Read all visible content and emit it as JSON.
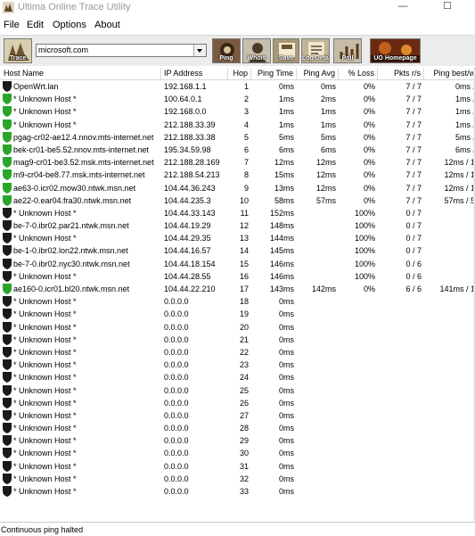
{
  "window": {
    "title": "Ultima Online Trace Utility",
    "minimize_glyph": "—",
    "maximize_glyph": "☐"
  },
  "menu": [
    "File",
    "Edit",
    "Options",
    "About"
  ],
  "toolbar": {
    "host_value": "microsoft.com",
    "buttons": [
      {
        "label": "Trace",
        "icon": "trace-icon",
        "color": "#d8cfae"
      },
      {
        "label": "Ping",
        "icon": "ping-icon",
        "color": "#7b5b3f"
      },
      {
        "label": "Whois",
        "icon": "whois-icon",
        "color": "#c9bfae"
      },
      {
        "label": "Save",
        "icon": "save-icon",
        "color": "#a89676"
      },
      {
        "label": "Log Details",
        "icon": "log-details-icon",
        "color": "#c2b596"
      },
      {
        "label": "Poll",
        "icon": "poll-icon",
        "color": "#c6bda7"
      },
      {
        "label": "UO Homepage",
        "icon": "uo-homepage-icon",
        "color": "#6a2a12"
      }
    ]
  },
  "columns": [
    "Host Name",
    "IP Address",
    "Hop",
    "Ping Time",
    "Ping Avg",
    "% Loss",
    "Pkts r/s",
    "Ping best/w"
  ],
  "status_colors": {
    "ok": "#2aa52a",
    "dark": "#1a1a1a"
  },
  "rows": [
    {
      "status": "dark",
      "host": "OpenWrt.lan",
      "ip": "192.168.1.1",
      "hop": "1",
      "time": "0ms",
      "avg": "0ms",
      "loss": "0%",
      "pkts": "7 / 7",
      "bw": "0ms /"
    },
    {
      "status": "ok",
      "host": "* Unknown Host *",
      "ip": "100.64.0.1",
      "hop": "2",
      "time": "1ms",
      "avg": "2ms",
      "loss": "0%",
      "pkts": "7 / 7",
      "bw": "1ms /"
    },
    {
      "status": "ok",
      "host": "* Unknown Host *",
      "ip": "192.168.0.0",
      "hop": "3",
      "time": "1ms",
      "avg": "1ms",
      "loss": "0%",
      "pkts": "7 / 7",
      "bw": "1ms /"
    },
    {
      "status": "ok",
      "host": "* Unknown Host *",
      "ip": "212.188.33.39",
      "hop": "4",
      "time": "1ms",
      "avg": "1ms",
      "loss": "0%",
      "pkts": "7 / 7",
      "bw": "1ms /"
    },
    {
      "status": "ok",
      "host": "pgag-cr02-ae12.4.nnov.mts-internet.net",
      "ip": "212.188.33.38",
      "hop": "5",
      "time": "5ms",
      "avg": "5ms",
      "loss": "0%",
      "pkts": "7 / 7",
      "bw": "5ms /"
    },
    {
      "status": "ok",
      "host": "bek-cr01-be5.52.nnov.mts-internet.net",
      "ip": "195.34.59.98",
      "hop": "6",
      "time": "6ms",
      "avg": "6ms",
      "loss": "0%",
      "pkts": "7 / 7",
      "bw": "6ms /"
    },
    {
      "status": "ok",
      "host": "mag9-cr01-be3.52.msk.mts-internet.net",
      "ip": "212.188.28.169",
      "hop": "7",
      "time": "12ms",
      "avg": "12ms",
      "loss": "0%",
      "pkts": "7 / 7",
      "bw": "12ms / 1"
    },
    {
      "status": "ok",
      "host": "m9-cr04-be8.77.msk.mts-internet.net",
      "ip": "212.188.54.213",
      "hop": "8",
      "time": "15ms",
      "avg": "12ms",
      "loss": "0%",
      "pkts": "7 / 7",
      "bw": "12ms / 1"
    },
    {
      "status": "ok",
      "host": "ae63-0.icr02.mow30.ntwk.msn.net",
      "ip": "104.44.36.243",
      "hop": "9",
      "time": "13ms",
      "avg": "12ms",
      "loss": "0%",
      "pkts": "7 / 7",
      "bw": "12ms / 1"
    },
    {
      "status": "ok",
      "host": "ae22-0.ear04.fra30.ntwk.msn.net",
      "ip": "104.44.235.3",
      "hop": "10",
      "time": "58ms",
      "avg": "57ms",
      "loss": "0%",
      "pkts": "7 / 7",
      "bw": "57ms / 5"
    },
    {
      "status": "dark",
      "host": "* Unknown Host *",
      "ip": "104.44.33.143",
      "hop": "11",
      "time": "152ms",
      "avg": "",
      "loss": "100%",
      "pkts": "0 / 7",
      "bw": ""
    },
    {
      "status": "dark",
      "host": "be-7-0.ibr02.par21.ntwk.msn.net",
      "ip": "104.44.19.29",
      "hop": "12",
      "time": "148ms",
      "avg": "",
      "loss": "100%",
      "pkts": "0 / 7",
      "bw": ""
    },
    {
      "status": "dark",
      "host": "* Unknown Host *",
      "ip": "104.44.29.35",
      "hop": "13",
      "time": "144ms",
      "avg": "",
      "loss": "100%",
      "pkts": "0 / 7",
      "bw": ""
    },
    {
      "status": "dark",
      "host": "be-1-0.ibr02.lon22.ntwk.msn.net",
      "ip": "104.44.16.57",
      "hop": "14",
      "time": "145ms",
      "avg": "",
      "loss": "100%",
      "pkts": "0 / 7",
      "bw": ""
    },
    {
      "status": "dark",
      "host": "be-7-0.ibr02.nyc30.ntwk.msn.net",
      "ip": "104.44.18.154",
      "hop": "15",
      "time": "146ms",
      "avg": "",
      "loss": "100%",
      "pkts": "0 / 6",
      "bw": ""
    },
    {
      "status": "dark",
      "host": "* Unknown Host *",
      "ip": "104.44.28.55",
      "hop": "16",
      "time": "146ms",
      "avg": "",
      "loss": "100%",
      "pkts": "0 / 6",
      "bw": ""
    },
    {
      "status": "ok",
      "host": "ae160-0.icr01.bl20.ntwk.msn.net",
      "ip": "104.44.22.210",
      "hop": "17",
      "time": "143ms",
      "avg": "142ms",
      "loss": "0%",
      "pkts": "6 / 6",
      "bw": "141ms / 1"
    },
    {
      "status": "dark",
      "host": "* Unknown Host *",
      "ip": "0.0.0.0",
      "hop": "18",
      "time": "0ms",
      "avg": "",
      "loss": "",
      "pkts": "",
      "bw": ""
    },
    {
      "status": "dark",
      "host": "* Unknown Host *",
      "ip": "0.0.0.0",
      "hop": "19",
      "time": "0ms",
      "avg": "",
      "loss": "",
      "pkts": "",
      "bw": ""
    },
    {
      "status": "dark",
      "host": "* Unknown Host *",
      "ip": "0.0.0.0",
      "hop": "20",
      "time": "0ms",
      "avg": "",
      "loss": "",
      "pkts": "",
      "bw": ""
    },
    {
      "status": "dark",
      "host": "* Unknown Host *",
      "ip": "0.0.0.0",
      "hop": "21",
      "time": "0ms",
      "avg": "",
      "loss": "",
      "pkts": "",
      "bw": ""
    },
    {
      "status": "dark",
      "host": "* Unknown Host *",
      "ip": "0.0.0.0",
      "hop": "22",
      "time": "0ms",
      "avg": "",
      "loss": "",
      "pkts": "",
      "bw": ""
    },
    {
      "status": "dark",
      "host": "* Unknown Host *",
      "ip": "0.0.0.0",
      "hop": "23",
      "time": "0ms",
      "avg": "",
      "loss": "",
      "pkts": "",
      "bw": ""
    },
    {
      "status": "dark",
      "host": "* Unknown Host *",
      "ip": "0.0.0.0",
      "hop": "24",
      "time": "0ms",
      "avg": "",
      "loss": "",
      "pkts": "",
      "bw": ""
    },
    {
      "status": "dark",
      "host": "* Unknown Host *",
      "ip": "0.0.0.0",
      "hop": "25",
      "time": "0ms",
      "avg": "",
      "loss": "",
      "pkts": "",
      "bw": ""
    },
    {
      "status": "dark",
      "host": "* Unknown Host *",
      "ip": "0.0.0.0",
      "hop": "26",
      "time": "0ms",
      "avg": "",
      "loss": "",
      "pkts": "",
      "bw": ""
    },
    {
      "status": "dark",
      "host": "* Unknown Host *",
      "ip": "0.0.0.0",
      "hop": "27",
      "time": "0ms",
      "avg": "",
      "loss": "",
      "pkts": "",
      "bw": ""
    },
    {
      "status": "dark",
      "host": "* Unknown Host *",
      "ip": "0.0.0.0",
      "hop": "28",
      "time": "0ms",
      "avg": "",
      "loss": "",
      "pkts": "",
      "bw": ""
    },
    {
      "status": "dark",
      "host": "* Unknown Host *",
      "ip": "0.0.0.0",
      "hop": "29",
      "time": "0ms",
      "avg": "",
      "loss": "",
      "pkts": "",
      "bw": ""
    },
    {
      "status": "dark",
      "host": "* Unknown Host *",
      "ip": "0.0.0.0",
      "hop": "30",
      "time": "0ms",
      "avg": "",
      "loss": "",
      "pkts": "",
      "bw": ""
    },
    {
      "status": "dark",
      "host": "* Unknown Host *",
      "ip": "0.0.0.0",
      "hop": "31",
      "time": "0ms",
      "avg": "",
      "loss": "",
      "pkts": "",
      "bw": ""
    },
    {
      "status": "dark",
      "host": "* Unknown Host *",
      "ip": "0.0.0.0",
      "hop": "32",
      "time": "0ms",
      "avg": "",
      "loss": "",
      "pkts": "",
      "bw": ""
    },
    {
      "status": "dark",
      "host": "* Unknown Host *",
      "ip": "0.0.0.0",
      "hop": "33",
      "time": "0ms",
      "avg": "",
      "loss": "",
      "pkts": "",
      "bw": ""
    }
  ],
  "status_text": "Continuous ping halted"
}
